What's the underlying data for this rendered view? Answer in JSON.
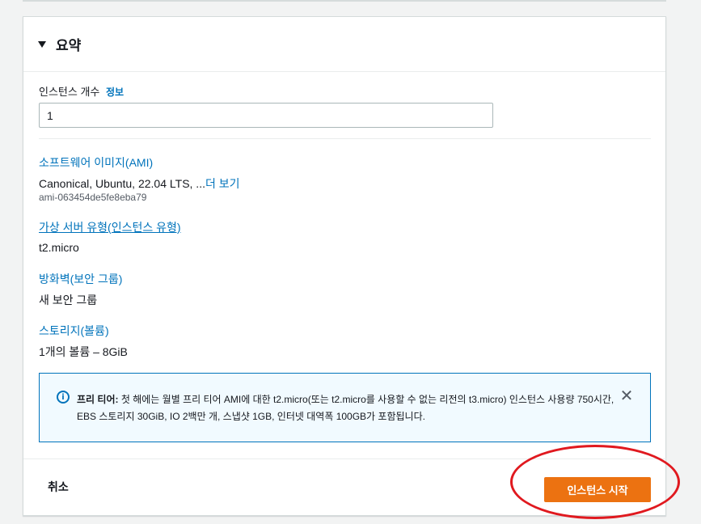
{
  "summary": {
    "title": "요약",
    "instance_count_label": "인스턴스 개수",
    "info_link": "정보",
    "instance_count_value": "1",
    "ami_label": "소프트웨어 이미지(AMI)",
    "ami_value": "Canonical, Ubuntu, 22.04 LTS, ...",
    "ami_more_link": "더 보기",
    "ami_id": "ami-063454de5fe8eba79",
    "instance_type_label": "가상 서버 유형(인스턴스 유형)",
    "instance_type_value": "t2.micro",
    "firewall_label": "방화벽(보안 그룹)",
    "firewall_value": "새 보안 그룹",
    "storage_label": "스토리지(볼륨)",
    "storage_value": "1개의 볼륨 – 8GiB"
  },
  "alert": {
    "icon": "info-icon",
    "heading": "프리 티어:",
    "message": "첫 해에는 월별 프리 티어 AMI에 대한 t2.micro(또는 t2.micro를 사용할 수 없는 리전의 t3.micro) 인스턴스 사용량 750시간, EBS 스토리지 30GiB, IO 2백만 개, 스냅샷 1GB, 인터넷 대역폭 100GB가 포함됩니다."
  },
  "footer": {
    "cancel_label": "취소",
    "launch_label": "인스턴스 시작"
  },
  "colors": {
    "link": "#0073bb",
    "primary_button": "#ec7211",
    "annotation": "#e0191f",
    "alert_bg": "#f1faff"
  }
}
